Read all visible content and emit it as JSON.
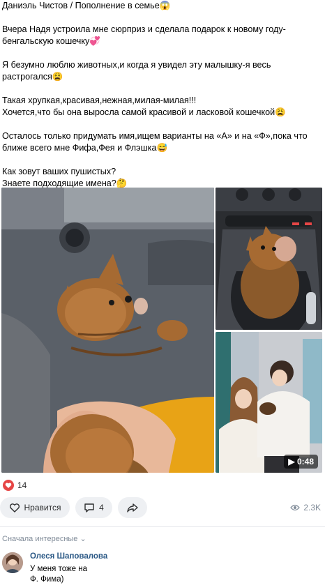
{
  "post": {
    "title_line": "Даниэль Чистов / Пополнение в семье😱",
    "paragraphs": [
      "Вчера Надя устроила мне сюрприз и сделала подарок к новому году-бенгальскую кошечку💞",
      "Я безумно люблю животных,и когда я увидел эту малышку-я весь растрогался😩",
      "Такая хрупкая,красивая,нежная,милая-милая!!!\nХочется,что бы она выросла самой красивой и ласковой кошечкой😩",
      "Осталось только придумать имя,ищем варианты на «А» и на «Ф»,пока что ближе всего мне Фифа,Фея и Флэшка😅",
      "Как зовут ваших пушистых?\nЗнаете подходящие имена?🤔"
    ]
  },
  "media": {
    "video_duration": "0:48",
    "photos": [
      "kitten-in-hand",
      "kitten-in-car-console",
      "couple-with-kitten-video"
    ]
  },
  "stats": {
    "likes_count": "14",
    "views": "2.3K"
  },
  "actions": {
    "like_label": "Нравится",
    "comments_count": "4"
  },
  "comments": {
    "sort_label": "Сначала интересные",
    "items": [
      {
        "author": "Олеся Шаповалова",
        "text": "У меня тоже на Ф. Фима)"
      }
    ]
  },
  "colors": {
    "accent_red": "#e64646",
    "link_blue": "#2a5885",
    "muted": "#818c99",
    "pill_bg": "#eef0f3"
  }
}
